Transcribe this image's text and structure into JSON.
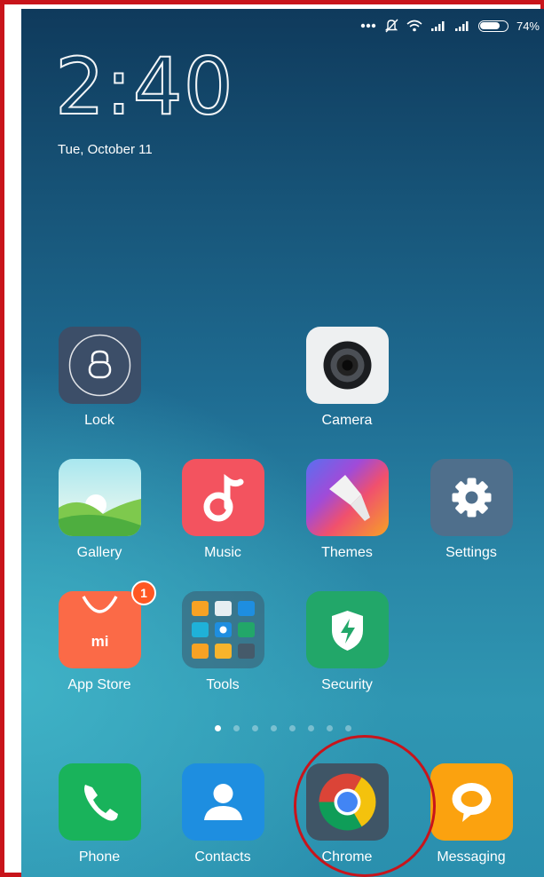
{
  "status_bar": {
    "icons": [
      "more-dots-icon",
      "silent-bell-icon",
      "wifi-icon",
      "signal-icon",
      "signal-icon",
      "battery-icon"
    ],
    "battery_level": 0.74,
    "battery_text": "74%"
  },
  "lockscreen": {
    "time_hours": "2",
    "time_sep": ":",
    "time_minutes": "40",
    "date": "Tue, October 11"
  },
  "apps": {
    "lock": "Lock",
    "camera": "Camera",
    "gallery": "Gallery",
    "music": "Music",
    "themes": "Themes",
    "settings": "Settings",
    "app_store": "App Store",
    "app_store_badge": "1",
    "tools": "Tools",
    "security": "Security"
  },
  "page_indicator": {
    "pages": 8,
    "current": 1
  },
  "dock": {
    "phone": "Phone",
    "contacts": "Contacts",
    "chrome": "Chrome",
    "messaging": "Messaging"
  },
  "colors": {
    "highlight": "#c8141b",
    "music": "#f3535f",
    "settings": "#4f6f8c",
    "app_store": "#fb6a47",
    "security": "#22a769",
    "phone": "#19b35b",
    "contacts": "#1e8ee0",
    "messaging": "#fba20f"
  }
}
